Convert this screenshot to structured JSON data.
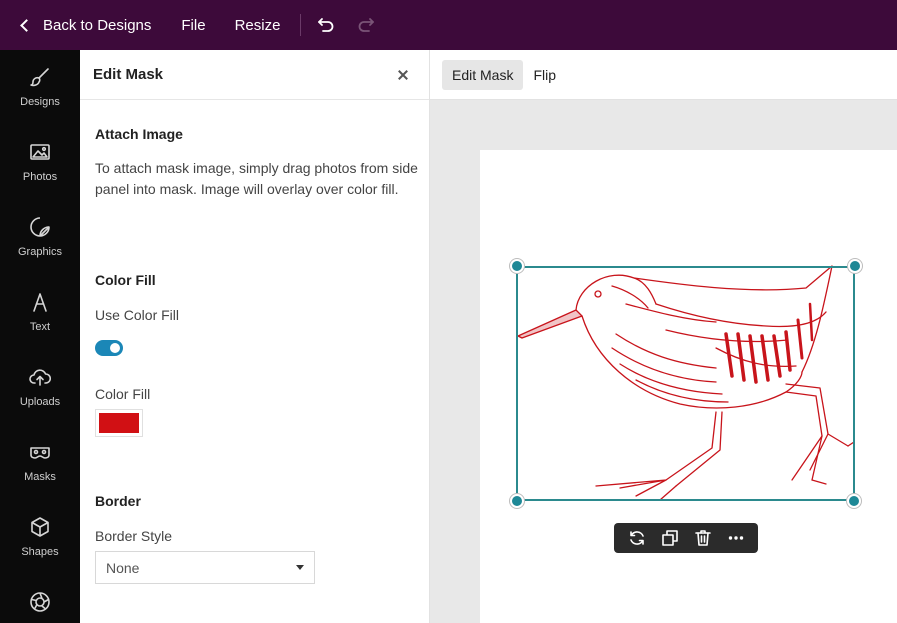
{
  "topbar": {
    "back_label": "Back to Designs",
    "file_label": "File",
    "resize_label": "Resize"
  },
  "rail": {
    "items": [
      {
        "label": "Designs",
        "icon": "brush-icon"
      },
      {
        "label": "Photos",
        "icon": "image-icon"
      },
      {
        "label": "Graphics",
        "icon": "sticker-icon"
      },
      {
        "label": "Text",
        "icon": "text-icon"
      },
      {
        "label": "Uploads",
        "icon": "cloud-upload-icon"
      },
      {
        "label": "Masks",
        "icon": "mask-icon"
      },
      {
        "label": "Shapes",
        "icon": "cube-icon"
      },
      {
        "label": "",
        "icon": "aperture-icon"
      }
    ]
  },
  "panel": {
    "title": "Edit Mask",
    "attach_title": "Attach Image",
    "attach_desc": "To attach mask image, simply drag photos from side panel into mask. Image will overlay over color fill.",
    "color_fill_title": "Color Fill",
    "use_color_fill_label": "Use Color Fill",
    "use_color_fill_on": true,
    "color_fill_label": "Color Fill",
    "color_fill_value": "#d11014",
    "border_title": "Border",
    "border_style_label": "Border Style",
    "border_style_value": "None"
  },
  "toolbar": {
    "edit_mask_label": "Edit Mask",
    "flip_label": "Flip"
  },
  "colors": {
    "topbar": "#3d0a3a",
    "accent": "#1e8896",
    "illustration": "#c8141b"
  }
}
